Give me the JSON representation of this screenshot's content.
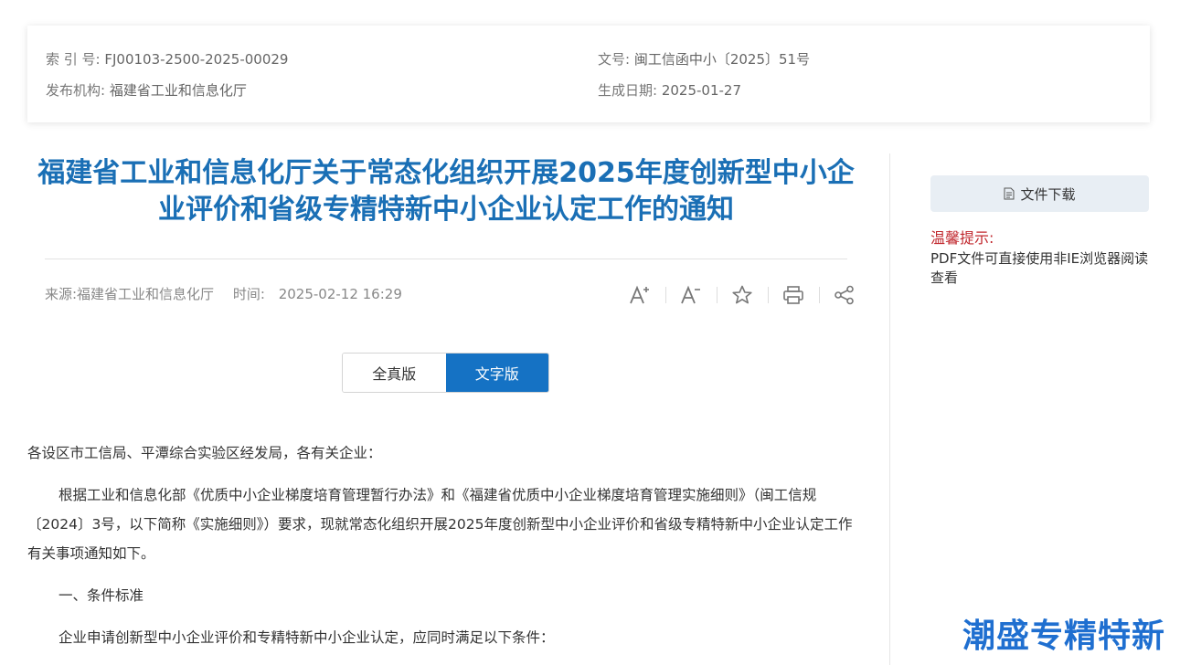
{
  "meta": {
    "index_label": "索 引 号:",
    "index_value": "FJ00103-2500-2025-00029",
    "doc_no_label": "文号:",
    "doc_no_value": "闽工信函中小〔2025〕51号",
    "org_label": "发布机构:",
    "org_value": "福建省工业和信息化厅",
    "date_label": "生成日期:",
    "date_value": "2025-01-27"
  },
  "article": {
    "title": "福建省工业和信息化厅关于常态化组织开展2025年度创新型中小企业评价和省级专精特新中小企业认定工作的通知",
    "source": "来源:福建省工业和信息化厅",
    "time_label": "时间:",
    "time_value": "2025-02-12 16:29"
  },
  "tools": {
    "icons": [
      "font-increase-icon",
      "font-decrease-icon",
      "star-icon",
      "print-icon",
      "share-icon"
    ]
  },
  "view_switch": {
    "full_label": "全真版",
    "text_label": "文字版",
    "active": "text"
  },
  "body": {
    "salutation": "各设区市工信局、平潭综合实验区经发局，各有关企业：",
    "para1": "根据工业和信息化部《优质中小企业梯度培育管理暂行办法》和《福建省优质中小企业梯度培育管理实施细则》（闽工信规〔2024〕3号，以下简称《实施细则》）要求，现就常态化组织开展2025年度创新型中小企业评价和省级专精特新中小企业认定工作有关事项通知如下。",
    "section1": "一、条件标准",
    "para2": "企业申请创新型中小企业评价和专精特新中小企业认定，应同时满足以下条件："
  },
  "sidebar": {
    "download_label": "文件下载",
    "tip_title": "温馨提示:",
    "tip_text": "PDF文件可直接使用非IE浏览器阅读查看"
  },
  "watermark": "潮盛专精特新",
  "colors": {
    "title_blue": "#1a6fb5",
    "active_tab_blue": "#1572c4",
    "tip_red": "#c0272d",
    "watermark_blue": "#1f6fd0"
  }
}
